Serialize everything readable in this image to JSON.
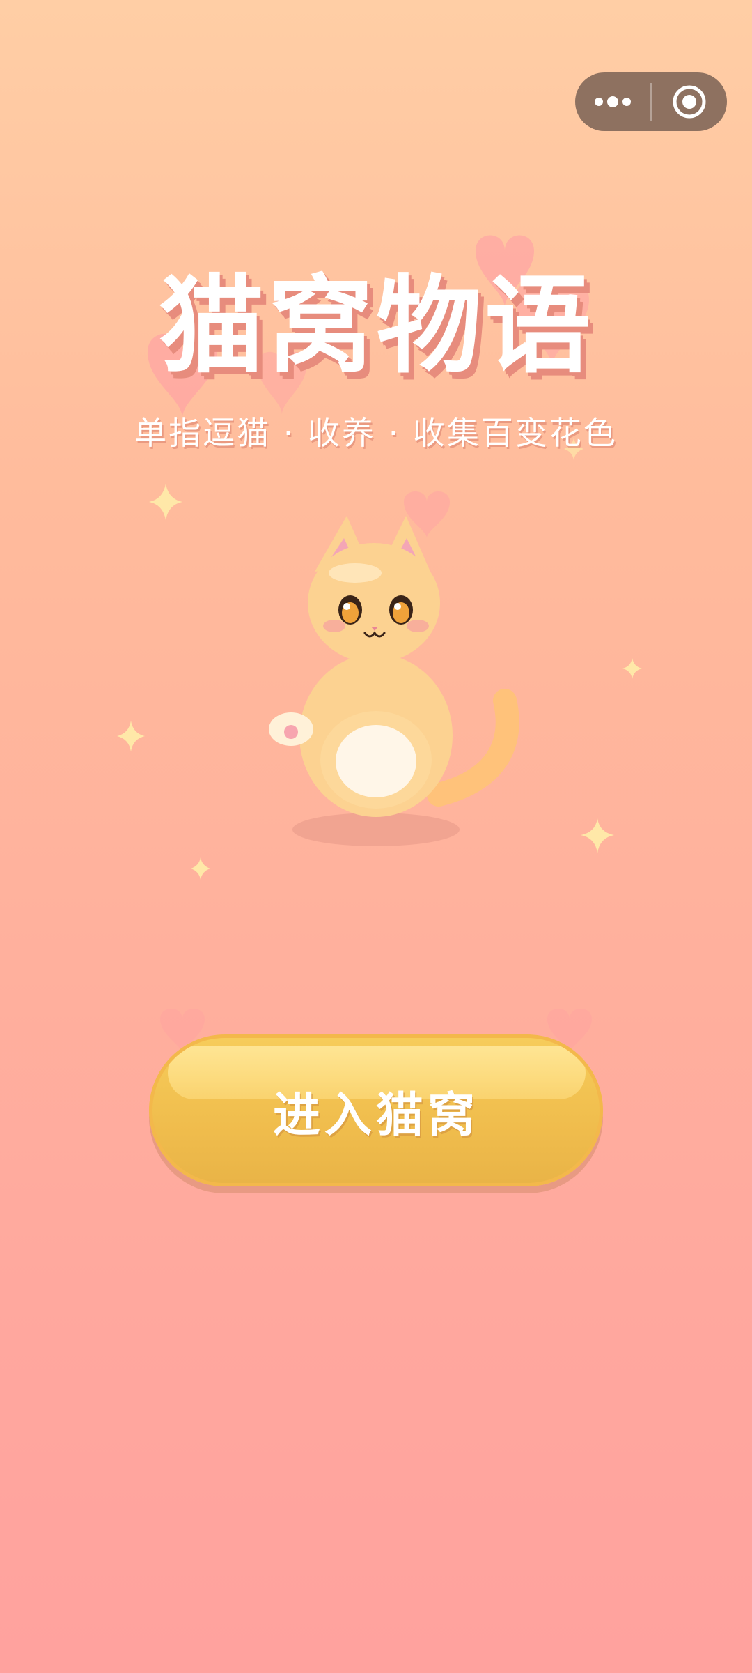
{
  "app": {
    "title": "猫窝物语",
    "subtitle": "单指逗猫 · 收养 · 收集百变花色"
  },
  "capsule": {
    "more_icon": "more-dots-icon",
    "close_icon": "target-circle-icon"
  },
  "main": {
    "enter_label": "进入猫窝"
  },
  "colors": {
    "background_top": "#FFCEA5",
    "background_bottom": "#FFA29E",
    "button": "#F0BD4D",
    "title_shadow": "#E78C7D",
    "cat_fur": "#FCD291"
  }
}
